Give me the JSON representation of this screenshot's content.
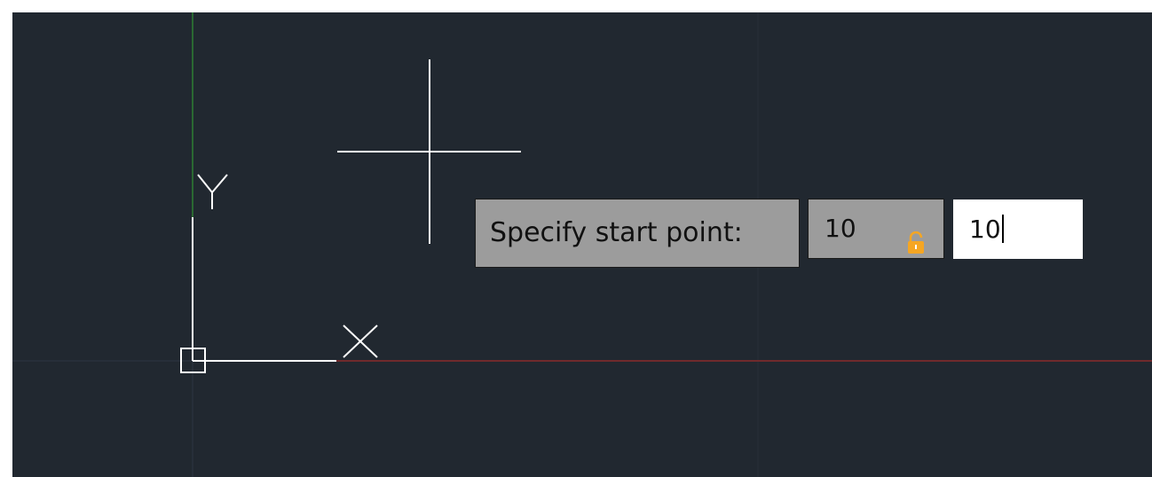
{
  "canvas": {
    "background": "#212830",
    "grid_color": "#2b3440",
    "x_axis_color": "#8b2a2a",
    "y_axis_color": "#2e7d32",
    "ucs_color": "#ffffff"
  },
  "ucs_icon": {
    "x_label": "X",
    "y_label": "Y"
  },
  "crosshair": {
    "icon": "crosshair-cursor"
  },
  "dynamic_input": {
    "prompt_label": "Specify start point:",
    "locked_value": "10",
    "lock_icon": "lock-icon",
    "lock_color": "#f5a623",
    "current_value": "10"
  }
}
